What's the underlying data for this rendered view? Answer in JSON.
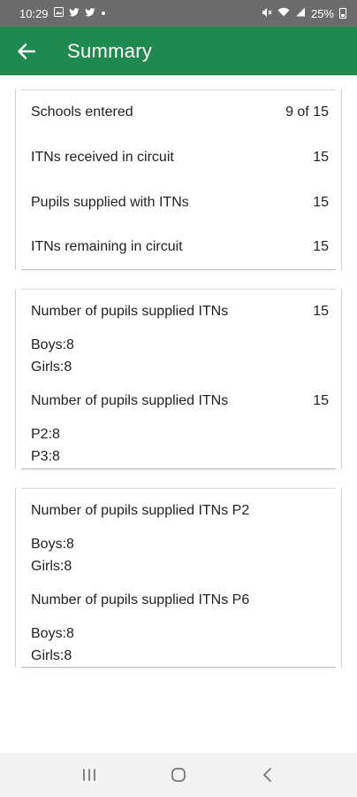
{
  "status_bar": {
    "time": "10:29",
    "battery": "25%"
  },
  "app_bar": {
    "title": "Summary",
    "back_icon": "arrow-left-icon"
  },
  "summary_card": {
    "rows": [
      {
        "label": "Schools entered",
        "value": "9 of 15"
      },
      {
        "label": "ITNs received in circuit",
        "value": "15"
      },
      {
        "label": "Pupils supplied with ITNs",
        "value": "15"
      },
      {
        "label": "ITNs remaining in circuit",
        "value": "15"
      }
    ]
  },
  "gender_class_card": {
    "gender_heading": "Number of pupils supplied ITNs",
    "gender_total": "15",
    "boys": "Boys:8",
    "girls": "Girls:8",
    "class_heading": "Number of pupils supplied ITNs",
    "class_total": "15",
    "p2": "P2:8",
    "p3": "P3:8"
  },
  "class_breakdown_card": {
    "p2_heading": "Number of pupils supplied ITNs P2",
    "p2_boys": "Boys:8",
    "p2_girls": "Girls:8",
    "p6_heading": "Number of pupils supplied ITNs P6",
    "p6_boys": "Boys:8",
    "p6_girls": "Girls:8"
  },
  "nav_bar": {
    "recents_icon": "recents-icon",
    "home_icon": "home-icon",
    "back_icon": "back-chevron-icon"
  }
}
